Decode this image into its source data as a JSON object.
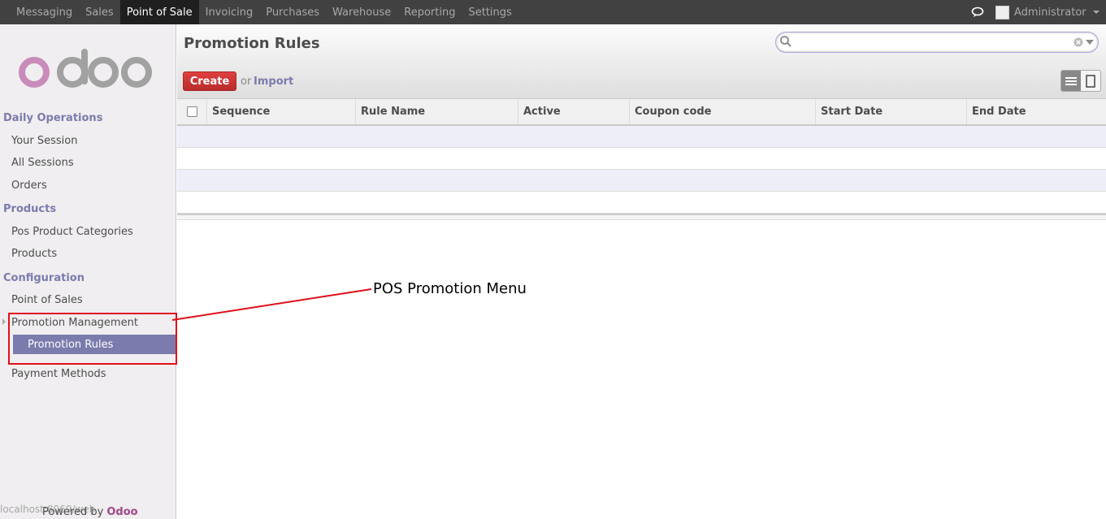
{
  "topbar": {
    "menu": [
      "Messaging",
      "Sales",
      "Point of Sale",
      "Invoicing",
      "Purchases",
      "Warehouse",
      "Reporting",
      "Settings"
    ],
    "active_index": 2,
    "user": "Administrator"
  },
  "sidebar": {
    "sections": [
      {
        "title": "Daily Operations",
        "items": [
          "Your Session",
          "All Sessions",
          "Orders"
        ]
      },
      {
        "title": "Products",
        "items": [
          "Pos Product Categories",
          "Products"
        ]
      },
      {
        "title": "Configuration",
        "items": [
          "Point of Sales",
          "Promotion Management",
          "Promotion Rules",
          "Payment Methods"
        ]
      }
    ],
    "active_item": "Promotion Rules",
    "powered_by": "Powered by",
    "brand": "Odoo",
    "status_url": "localhost:8069/web"
  },
  "header": {
    "title": "Promotion Rules",
    "create_label": "Create",
    "or_text": "or",
    "import_label": "Import",
    "search_placeholder": ""
  },
  "table": {
    "columns": [
      "Sequence",
      "Rule Name",
      "Active",
      "Coupon code",
      "Start Date",
      "End Date"
    ],
    "rows": []
  },
  "annotation": {
    "text": "POS Promotion Menu",
    "color": "#e0101a"
  },
  "colors": {
    "accent": "#7c7bad",
    "brand": "#a24689",
    "topbar": "#414141",
    "create": "#c53434"
  }
}
